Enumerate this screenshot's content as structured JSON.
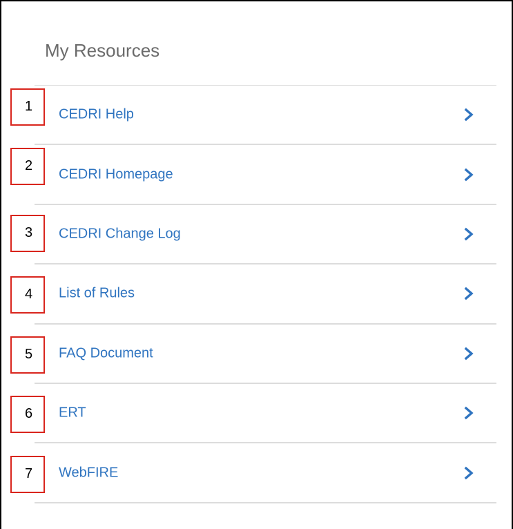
{
  "panel": {
    "title": "My Resources"
  },
  "resources": [
    {
      "number": "1",
      "label": "CEDRI Help"
    },
    {
      "number": "2",
      "label": "CEDRI Homepage"
    },
    {
      "number": "3",
      "label": "CEDRI Change Log"
    },
    {
      "number": "4",
      "label": "List of Rules"
    },
    {
      "number": "5",
      "label": "FAQ Document"
    },
    {
      "number": "6",
      "label": "ERT"
    },
    {
      "number": "7",
      "label": "WebFIRE"
    }
  ],
  "icons": {
    "row_arrow": "chevron-right-icon"
  },
  "colors": {
    "link": "#2f74c0",
    "callout_border": "#d9251d",
    "title": "#6b6b6b",
    "divider": "#dcdcdc"
  }
}
